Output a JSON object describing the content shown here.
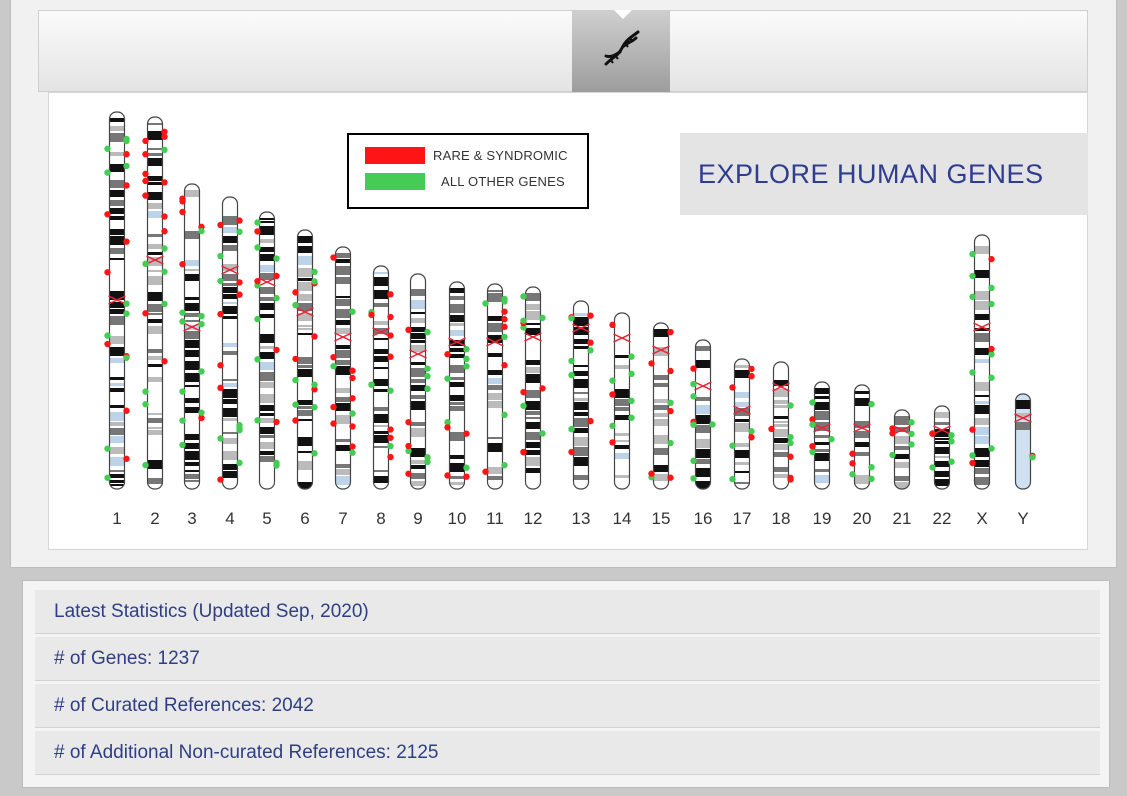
{
  "header": {
    "icon": "dna-icon"
  },
  "legend": {
    "rare_label": "RARE & SYNDROMIC",
    "rare_color": "#ff1515",
    "other_label": "ALL OTHER GENES",
    "other_color": "#44cc55"
  },
  "explore_label": "EXPLORE HUMAN GENES",
  "chromosomes": [
    "1",
    "2",
    "3",
    "4",
    "5",
    "6",
    "7",
    "8",
    "9",
    "10",
    "11",
    "12",
    "13",
    "14",
    "15",
    "16",
    "17",
    "18",
    "19",
    "20",
    "21",
    "22",
    "X",
    "Y"
  ],
  "stats": {
    "title": "Latest Statistics (Updated Sep, 2020)",
    "genes": "# of Genes: 1237",
    "curated": "# of Curated References: 2042",
    "additional": "# of Additional Non-curated References: 2125"
  }
}
